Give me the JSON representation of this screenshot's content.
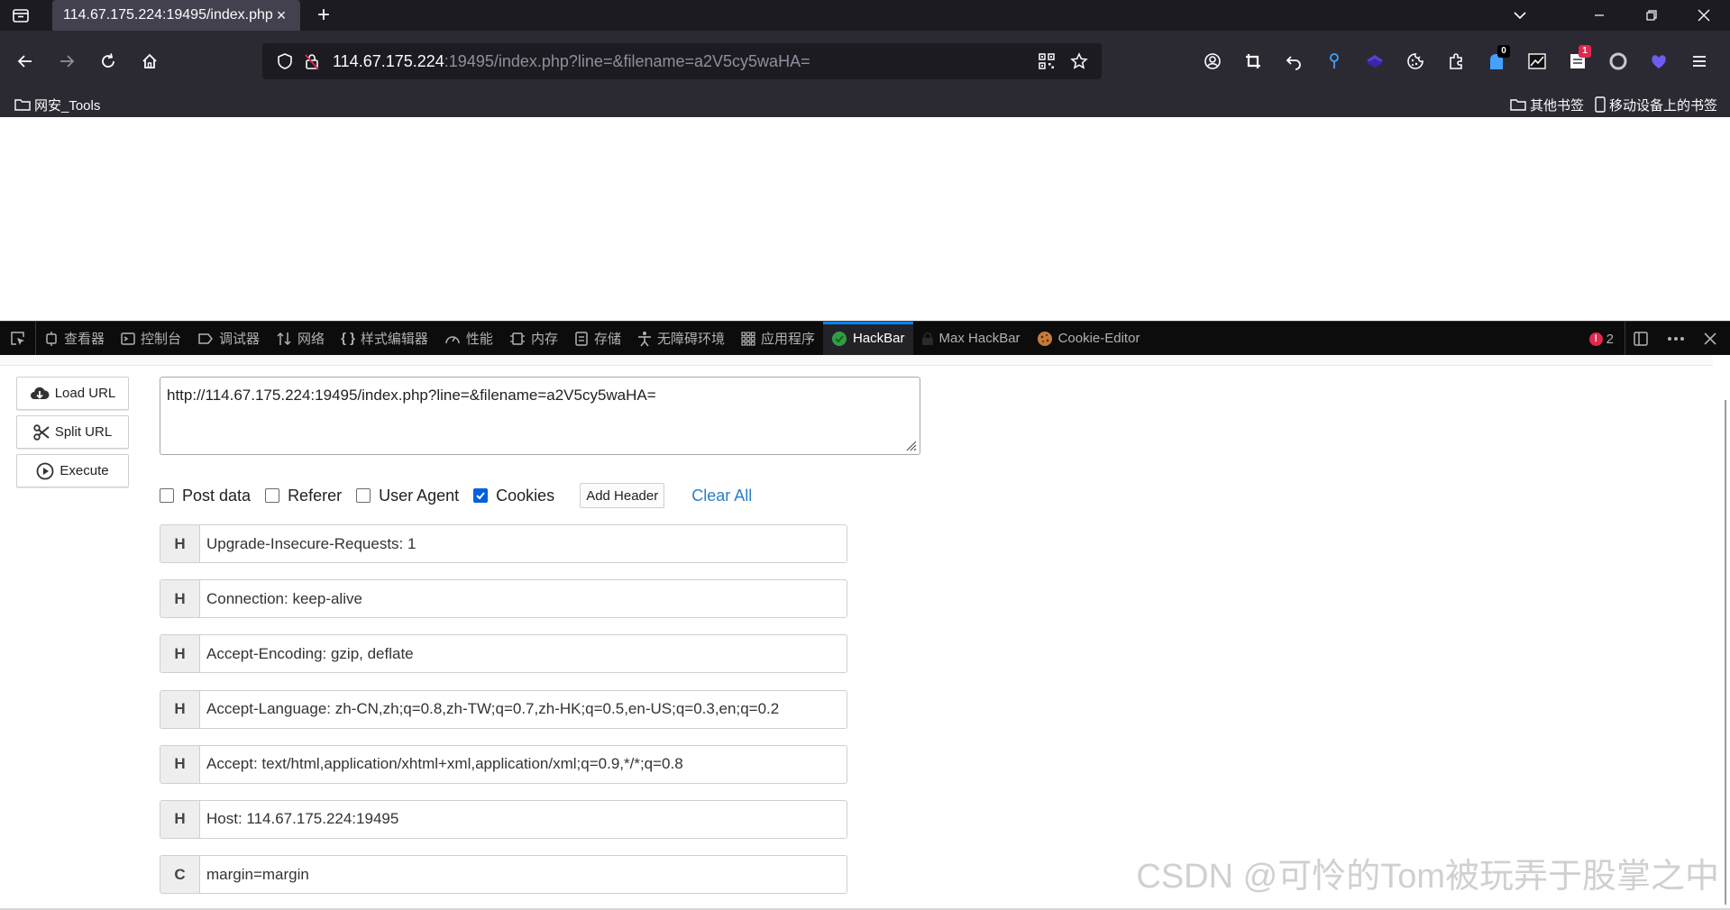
{
  "browser": {
    "tab": {
      "title": "114.67.175.224:19495/index.php",
      "close": "×"
    },
    "new_tab": "+",
    "url": {
      "host": "114.67.175.224",
      "rest": ":19495/index.php?line=&filename=a2V5cy5waHA="
    },
    "extension_badges": {
      "badge1": "0",
      "badge2": "1"
    },
    "bookmarks": {
      "left_folder": "网安_Tools",
      "other": "其他书签",
      "mobile": "移动设备上的书签"
    }
  },
  "devtools": {
    "tabs": [
      "查看器",
      "控制台",
      "调试器",
      "网络",
      "样式编辑器",
      "性能",
      "内存",
      "存储",
      "无障碍环境",
      "应用程序",
      "HackBar",
      "Max HackBar",
      "Cookie-Editor"
    ],
    "active_tab": "HackBar",
    "error_count": "2"
  },
  "hackbar": {
    "buttons": {
      "load": "Load URL",
      "split": "Split URL",
      "execute": "Execute"
    },
    "url_value": "http://114.67.175.224:19495/index.php?line=&filename=a2V5cy5waHA=",
    "options": {
      "post_data": "Post data",
      "referer": "Referer",
      "user_agent": "User Agent",
      "cookies": "Cookies",
      "cookies_checked": true,
      "add_header": "Add Header",
      "clear_all": "Clear All"
    },
    "headers": [
      {
        "type": "H",
        "value": "Upgrade-Insecure-Requests: 1"
      },
      {
        "type": "H",
        "value": "Connection: keep-alive"
      },
      {
        "type": "H",
        "value": "Accept-Encoding: gzip, deflate"
      },
      {
        "type": "H",
        "value": "Accept-Language: zh-CN,zh;q=0.8,zh-TW;q=0.7,zh-HK;q=0.5,en-US;q=0.3,en;q=0.2"
      },
      {
        "type": "H",
        "value": "Accept: text/html,application/xhtml+xml,application/xml;q=0.9,*/*;q=0.8"
      },
      {
        "type": "H",
        "value": "Host: 114.67.175.224:19495"
      },
      {
        "type": "C",
        "value": "margin=margin"
      }
    ]
  },
  "watermark": "CSDN @可怜的Tom被玩弄于股掌之中",
  "colors": {
    "active_tab_accent": "#0a84ff",
    "checkbox": "#0060df",
    "link": "#2a7fc7"
  }
}
